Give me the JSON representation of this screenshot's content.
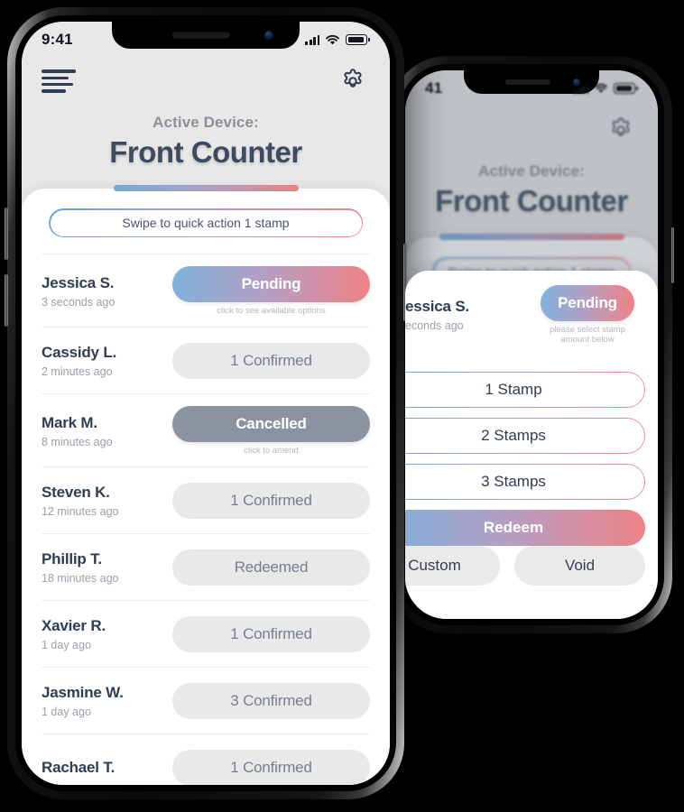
{
  "left_phone": {
    "status_bar": {
      "time": "9:41",
      "signal_icon": "signal-bars-icon",
      "wifi_icon": "wifi-icon",
      "battery_icon": "battery-icon"
    },
    "top_bar": {
      "menu_icon": "hamburger-menu-icon",
      "settings_icon": "gear-icon"
    },
    "header": {
      "subtitle": "Active Device:",
      "title": "Front Counter"
    },
    "swipe_action": {
      "label": "Swipe to quick action 1 stamp"
    },
    "list": [
      {
        "name": "Jessica S.",
        "time": "3 seconds ago",
        "status": "Pending",
        "style": "pending",
        "note": "click to see available options"
      },
      {
        "name": "Cassidy L.",
        "time": "2 minutes ago",
        "status": "1 Confirmed",
        "style": "plain",
        "note": ""
      },
      {
        "name": "Mark M.",
        "time": "8 minutes ago",
        "status": "Cancelled",
        "style": "cancelled",
        "note": "click to amend"
      },
      {
        "name": "Steven K.",
        "time": "12 minutes ago",
        "status": "1 Confirmed",
        "style": "plain",
        "note": ""
      },
      {
        "name": "Phillip T.",
        "time": "18 minutes ago",
        "status": "Redeemed",
        "style": "plain",
        "note": ""
      },
      {
        "name": "Xavier R.",
        "time": "1 day ago",
        "status": "1 Confirmed",
        "style": "plain",
        "note": ""
      },
      {
        "name": "Jasmine W.",
        "time": "1 day ago",
        "status": "3 Confirmed",
        "style": "plain",
        "note": ""
      },
      {
        "name": "Rachael T.",
        "time": "",
        "status": "1 Confirmed",
        "style": "plain",
        "note": ""
      }
    ]
  },
  "right_phone": {
    "status_bar": {
      "time": "41",
      "signal_icon": "signal-bars-icon",
      "wifi_icon": "wifi-icon",
      "battery_icon": "battery-icon"
    },
    "top_bar": {
      "settings_icon": "gear-icon"
    },
    "header": {
      "subtitle": "Active Device:",
      "title": "Front Counter"
    },
    "swipe_action": {
      "label": "Swipe to quick action 1 stamp"
    },
    "modal": {
      "customer": {
        "name": "essica S.",
        "time": "econds ago",
        "status": "Pending",
        "note": "please select stamp amount below"
      },
      "options": [
        {
          "label": "1 Stamp",
          "style": "outline"
        },
        {
          "label": "2 Stamps",
          "style": "outline"
        },
        {
          "label": "3 Stamps",
          "style": "outline"
        },
        {
          "label": "Redeem",
          "style": "redeem"
        }
      ],
      "footer": [
        {
          "label": "Custom"
        },
        {
          "label": "Void"
        }
      ]
    }
  },
  "colors": {
    "gradient_start": "#7fb2db",
    "gradient_end": "#ef8285",
    "title": "#3c4b5e",
    "subtitle": "#8c9199",
    "badge_plain_bg": "#e9e9e9",
    "badge_plain_text": "#768091",
    "cancelled_bg": "#8b93a1",
    "screen_bg": "#e8e8e8",
    "card_bg": "#ffffff"
  }
}
